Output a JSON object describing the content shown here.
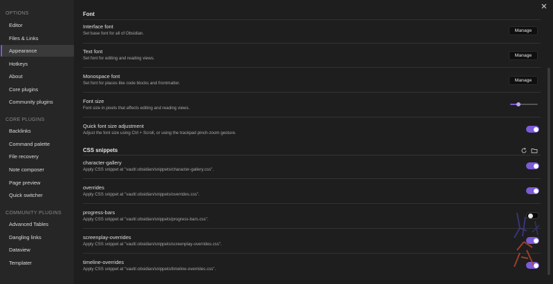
{
  "sidebar": {
    "options_header": "Options",
    "options": [
      {
        "label": "Editor",
        "name": "sidebar-item-editor"
      },
      {
        "label": "Files & Links",
        "name": "sidebar-item-files-links"
      },
      {
        "label": "Appearance",
        "name": "sidebar-item-appearance"
      },
      {
        "label": "Hotkeys",
        "name": "sidebar-item-hotkeys"
      },
      {
        "label": "About",
        "name": "sidebar-item-about"
      },
      {
        "label": "Core plugins",
        "name": "sidebar-item-core-plugins"
      },
      {
        "label": "Community plugins",
        "name": "sidebar-item-community-plugins"
      }
    ],
    "core_header": "Core plugins",
    "core": [
      {
        "label": "Backlinks",
        "name": "sidebar-item-backlinks"
      },
      {
        "label": "Command palette",
        "name": "sidebar-item-command-palette"
      },
      {
        "label": "File recovery",
        "name": "sidebar-item-file-recovery"
      },
      {
        "label": "Note composer",
        "name": "sidebar-item-note-composer"
      },
      {
        "label": "Page preview",
        "name": "sidebar-item-page-preview"
      },
      {
        "label": "Quick switcher",
        "name": "sidebar-item-quick-switcher"
      }
    ],
    "community_header": "Community plugins",
    "community": [
      {
        "label": "Advanced Tables",
        "name": "sidebar-item-advanced-tables"
      },
      {
        "label": "Dangling links",
        "name": "sidebar-item-dangling-links"
      },
      {
        "label": "Dataview",
        "name": "sidebar-item-dataview"
      },
      {
        "label": "Templater",
        "name": "sidebar-item-templater"
      }
    ]
  },
  "font_section": {
    "title": "Font",
    "interface_font": {
      "title": "Interface font",
      "desc": "Set base font for all of Obsidian.",
      "button": "Manage"
    },
    "text_font": {
      "title": "Text font",
      "desc": "Set font for editing and reading views.",
      "button": "Manage"
    },
    "monospace_font": {
      "title": "Monospace font",
      "desc": "Set font for places like code blocks and frontmatter.",
      "button": "Manage"
    },
    "font_size": {
      "title": "Font size",
      "desc": "Font size in pixels that affects editing and reading views.",
      "slider_fraction": 0.3
    },
    "quick_font_size": {
      "title": "Quick font size adjustment",
      "desc": "Adjust the font size using Ctrl + Scroll, or using the trackpad pinch-zoom gesture.",
      "enabled": true
    }
  },
  "snippets_section": {
    "title": "CSS snippets",
    "reload_icon": "reload-icon",
    "folder_icon": "folder-icon",
    "items": [
      {
        "title": "character-gallery",
        "desc": "Apply CSS snippet at \"vault/.obsidian/snippets/character-gallery.css\".",
        "enabled": true
      },
      {
        "title": "overrides",
        "desc": "Apply CSS snippet at \"vault/.obsidian/snippets/overrides.css\".",
        "enabled": true
      },
      {
        "title": "progress-bars",
        "desc": "Apply CSS snippet at \"vault/.obsidian/snippets/progress-bars.css\".",
        "enabled": false
      },
      {
        "title": "screenplay-overrides",
        "desc": "Apply CSS snippet at \"vault/.obsidian/snippets/screenplay-overrides.css\".",
        "enabled": true
      },
      {
        "title": "timeline-overrides",
        "desc": "Apply CSS snippet at \"vault/.obsidian/snippets/timeline-overrides.css\".",
        "enabled": true
      }
    ]
  },
  "close_icon": "close-icon",
  "colors": {
    "accent": "#7b5bd6",
    "background": "#1e1e1e",
    "sidebar": "#262626"
  }
}
